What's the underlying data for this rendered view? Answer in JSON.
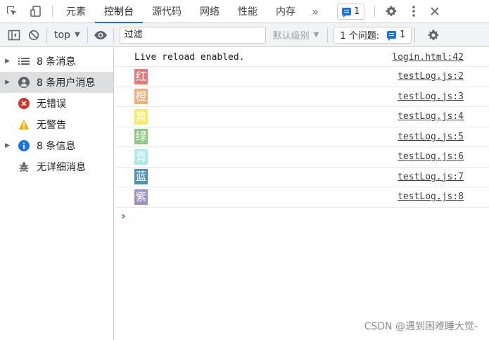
{
  "tabs": [
    {
      "label": "元素",
      "active": false
    },
    {
      "label": "控制台",
      "active": true
    },
    {
      "label": "源代码",
      "active": false
    },
    {
      "label": "网络",
      "active": false
    },
    {
      "label": "性能",
      "active": false
    },
    {
      "label": "内存",
      "active": false
    }
  ],
  "tabbar": {
    "more": "»",
    "message_count": "1"
  },
  "toolbar": {
    "context": "top",
    "filter_placeholder": "过滤",
    "levels": "默认级别",
    "issues_label": "1 个问题:",
    "issues_count": "1"
  },
  "sidebar": {
    "items": [
      {
        "label": "8 条消息",
        "icon": "list-icon"
      },
      {
        "label": "8 条用户消息",
        "icon": "user-icon"
      },
      {
        "label": "无错误",
        "icon": "error-icon"
      },
      {
        "label": "无警告",
        "icon": "warning-icon"
      },
      {
        "label": "8 条信息",
        "icon": "info-icon"
      },
      {
        "label": "无详细消息",
        "icon": "bug-icon"
      }
    ]
  },
  "console": {
    "rows": [
      {
        "text": "Live reload enabled.",
        "source": "login.html:42"
      },
      {
        "text": "红",
        "source": "testLog.js:2",
        "color": "#e06666"
      },
      {
        "text": "橙",
        "source": "testLog.js:3",
        "color": "#f0a060"
      },
      {
        "text": "黄",
        "source": "testLog.js:4",
        "color": "#f5e84a"
      },
      {
        "text": "绿",
        "source": "testLog.js:5",
        "color": "#7cbf6a"
      },
      {
        "text": "青",
        "source": "testLog.js:6",
        "color": "#9ee6ea"
      },
      {
        "text": "蓝",
        "source": "testLog.js:7",
        "color": "#2f7ea8"
      },
      {
        "text": "紫",
        "source": "testLog.js:8",
        "color": "#8a7fb8"
      }
    ],
    "prompt": "›"
  },
  "watermark": "CSDN @遇到困难睡大觉-"
}
